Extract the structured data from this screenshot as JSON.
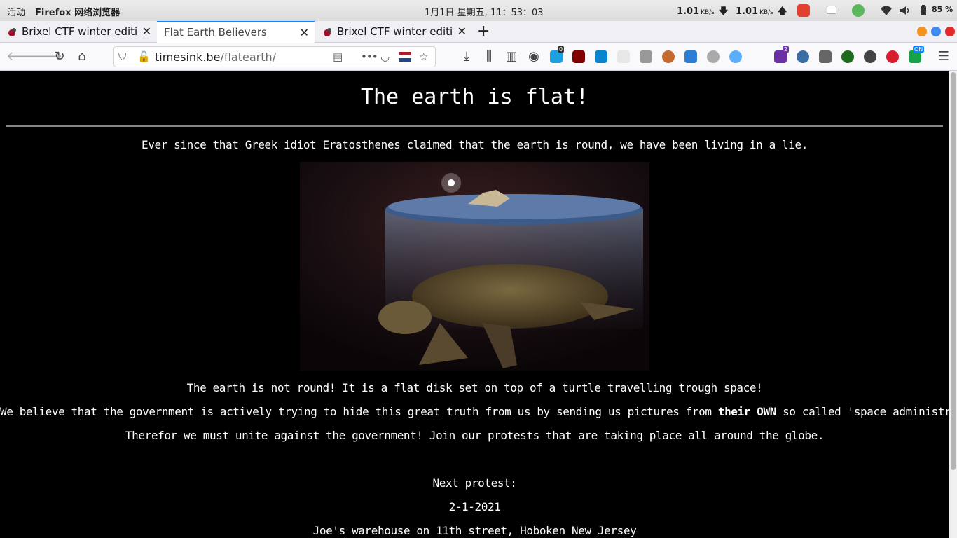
{
  "system_bar": {
    "activities": "活动",
    "app_menu": "Firefox 网络浏览器",
    "clock": "1月1日 星期五, 11：53：03",
    "net_down": "1.01",
    "net_down_unit": "KB/s",
    "net_up": "1.01",
    "net_up_unit": "KB/s",
    "battery": "85 %"
  },
  "tabs": [
    {
      "label": "Brixel CTF winter edition",
      "close": "✕"
    },
    {
      "label": "Flat Earth Believers",
      "close": "✕",
      "active": true
    },
    {
      "label": "Brixel CTF winter edition",
      "close": "✕"
    }
  ],
  "new_tab": "+",
  "nav": {
    "url_host": "timesink.be",
    "url_path": "/flatearth/",
    "more_label": "•••",
    "extension_badges": {
      "ext_counter": "0",
      "ext_counter2": "2",
      "ext_on": "ON"
    }
  },
  "page": {
    "heading": "The earth is flat!",
    "intro": "Ever since that Greek idiot Eratosthenes claimed that the earth is round, we have been living in a lie.",
    "image_alt": "flat earth on a turtle",
    "para1": "The earth is not round! It is a flat disk set on top of a turtle travelling trough space!",
    "para2_pre": "We believe that the government is actively trying to hide this great truth from us by sending us pictures from ",
    "para2_emph": "their OWN",
    "para2_post": " so called 'space administration' or 'nasa'",
    "para3": "Therefor we must unite against the government! Join our protests that are taking place all around the globe.",
    "next_protest_label": "Next protest:",
    "next_protest_date": "2-1-2021",
    "next_protest_location": "Joe's warehouse on 11th street, Hoboken New Jersey"
  },
  "colors": {
    "accent": "#0a84ff",
    "page_bg": "#000000",
    "page_text": "#ffffff"
  }
}
